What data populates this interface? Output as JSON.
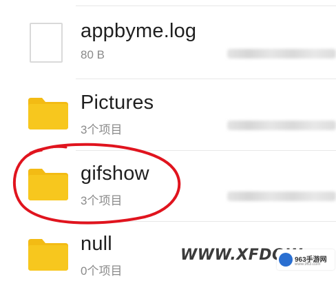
{
  "files": [
    {
      "name": "appbyme.log",
      "meta": "80 B",
      "icon": "document-icon"
    },
    {
      "name": "Pictures",
      "meta": "3个项目",
      "icon": "folder-icon"
    },
    {
      "name": "gifshow",
      "meta": "3个项目",
      "icon": "folder-icon"
    },
    {
      "name": "null",
      "meta": "0个项目",
      "icon": "folder-icon"
    }
  ],
  "colors": {
    "folder": "#f7c71e",
    "folder_tab": "#f3bb14",
    "annotation": "#e0141e",
    "file_name": "#1f1f1f",
    "file_meta": "#8a8a8a"
  },
  "watermark": {
    "text": "WWW.XFDOW",
    "logo_text": "963手游网",
    "logo_sub": "www.963.com"
  }
}
